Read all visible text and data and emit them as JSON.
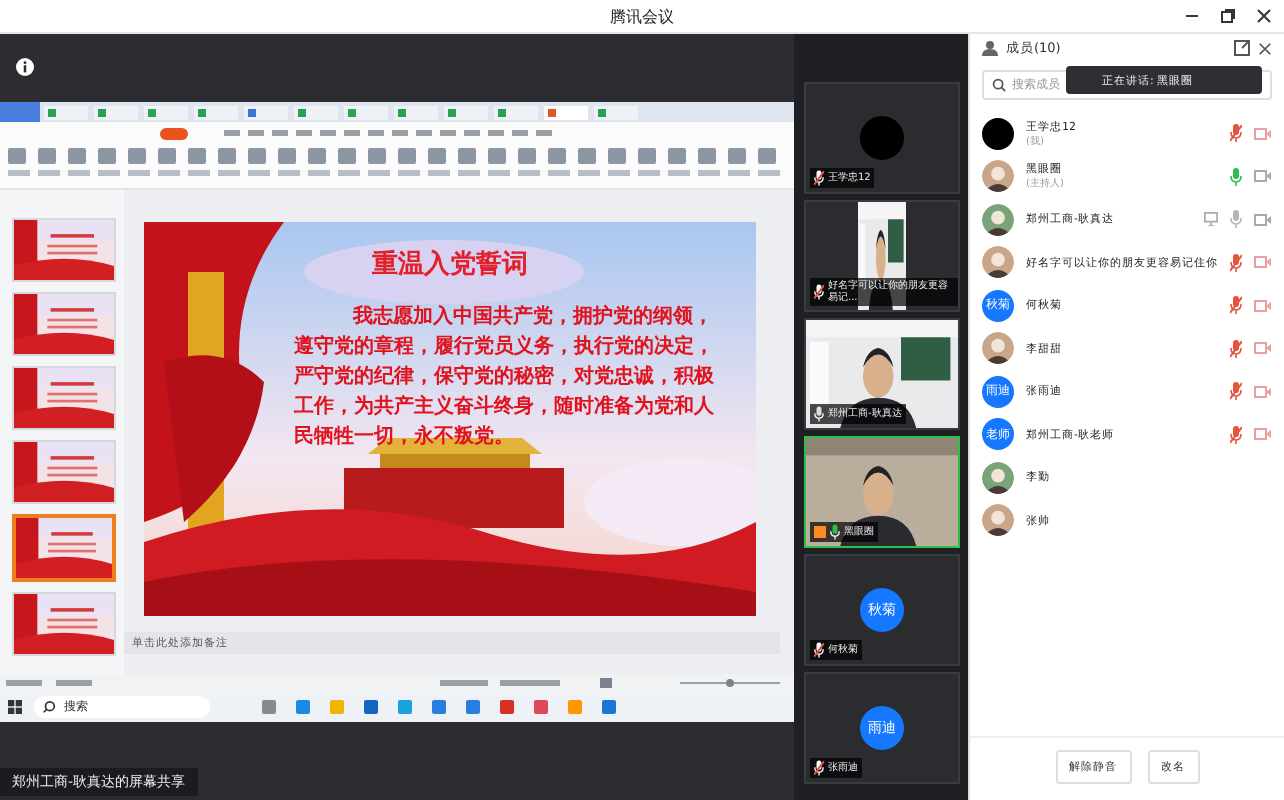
{
  "window": {
    "title": "腾讯会议"
  },
  "share": {
    "presenter_label": "郑州工商-耿真达的屏幕共享",
    "slide": {
      "title": "重温入党誓词",
      "body": "我志愿加入中国共产党，拥护党的纲领，遵守党的章程，履行党员义务，执行党的决定，严守党的纪律，保守党的秘密，对党忠诚，积极工作，为共产主义奋斗终身，随时准备为党和人民牺牲一切，永不叛党。"
    },
    "thumbnails": [
      {
        "selected": false
      },
      {
        "selected": false
      },
      {
        "selected": false
      },
      {
        "selected": false
      },
      {
        "selected": true
      },
      {
        "selected": false
      }
    ],
    "notes_placeholder": "单击此处添加备注",
    "taskbar_search": "搜索"
  },
  "video_tiles": [
    {
      "kind": "dark",
      "name": "王学忠12",
      "muted": true,
      "host": false,
      "speaking": false
    },
    {
      "kind": "portrait",
      "name": "好名字可以让你的朋友更容易记...",
      "muted": true,
      "host": false,
      "speaking": false
    },
    {
      "kind": "camera",
      "name": "郑州工商-耿真达",
      "muted": false,
      "talking": false,
      "host": false,
      "speaking": false
    },
    {
      "kind": "camera",
      "name": "黑眼圈",
      "muted": false,
      "talking": true,
      "host": true,
      "speaking": true
    },
    {
      "kind": "initials",
      "initials": "秋菊",
      "name": "何秋菊",
      "muted": true,
      "host": false,
      "speaking": false
    },
    {
      "kind": "initials",
      "initials": "雨迪",
      "name": "张雨迪",
      "muted": true,
      "host": false,
      "speaking": false
    }
  ],
  "members": {
    "title": "成员(10)",
    "search_placeholder": "搜索成员",
    "toast": "正在讲话: 黑眼圈",
    "items": [
      {
        "kind": "dark",
        "name": "王学忠12",
        "role": "(我)",
        "mic": true,
        "muted": true,
        "camera": true,
        "sharing": false
      },
      {
        "name": "黑眼圈",
        "role": "(主持人)",
        "mic": true,
        "muted": false,
        "talking": true,
        "camera": true,
        "sharing": false
      },
      {
        "name": "郑州工商-耿真达",
        "mic": true,
        "muted": false,
        "talking": false,
        "camera": true,
        "sharing": true
      },
      {
        "name": "好名字可以让你的朋友更容易记住你",
        "mic": true,
        "muted": true,
        "camera": true,
        "sharing": false
      },
      {
        "kind": "initials",
        "initials": "秋菊",
        "name": "何秋菊",
        "mic": true,
        "muted": true,
        "camera": true,
        "sharing": false
      },
      {
        "name": "李甜甜",
        "mic": true,
        "muted": true,
        "camera": true,
        "sharing": false
      },
      {
        "kind": "initials",
        "initials": "雨迪",
        "name": "张雨迪",
        "mic": true,
        "muted": true,
        "camera": true,
        "sharing": false
      },
      {
        "kind": "initials",
        "initials": "老师",
        "name": "郑州工商-耿老师",
        "mic": true,
        "muted": true,
        "camera": true,
        "sharing": false
      },
      {
        "name": "李勤",
        "mic": false,
        "camera": false,
        "sharing": false
      },
      {
        "name": "张帅",
        "mic": false,
        "camera": false,
        "sharing": false
      }
    ]
  },
  "buttons": [
    "解除静音",
    "改名"
  ]
}
